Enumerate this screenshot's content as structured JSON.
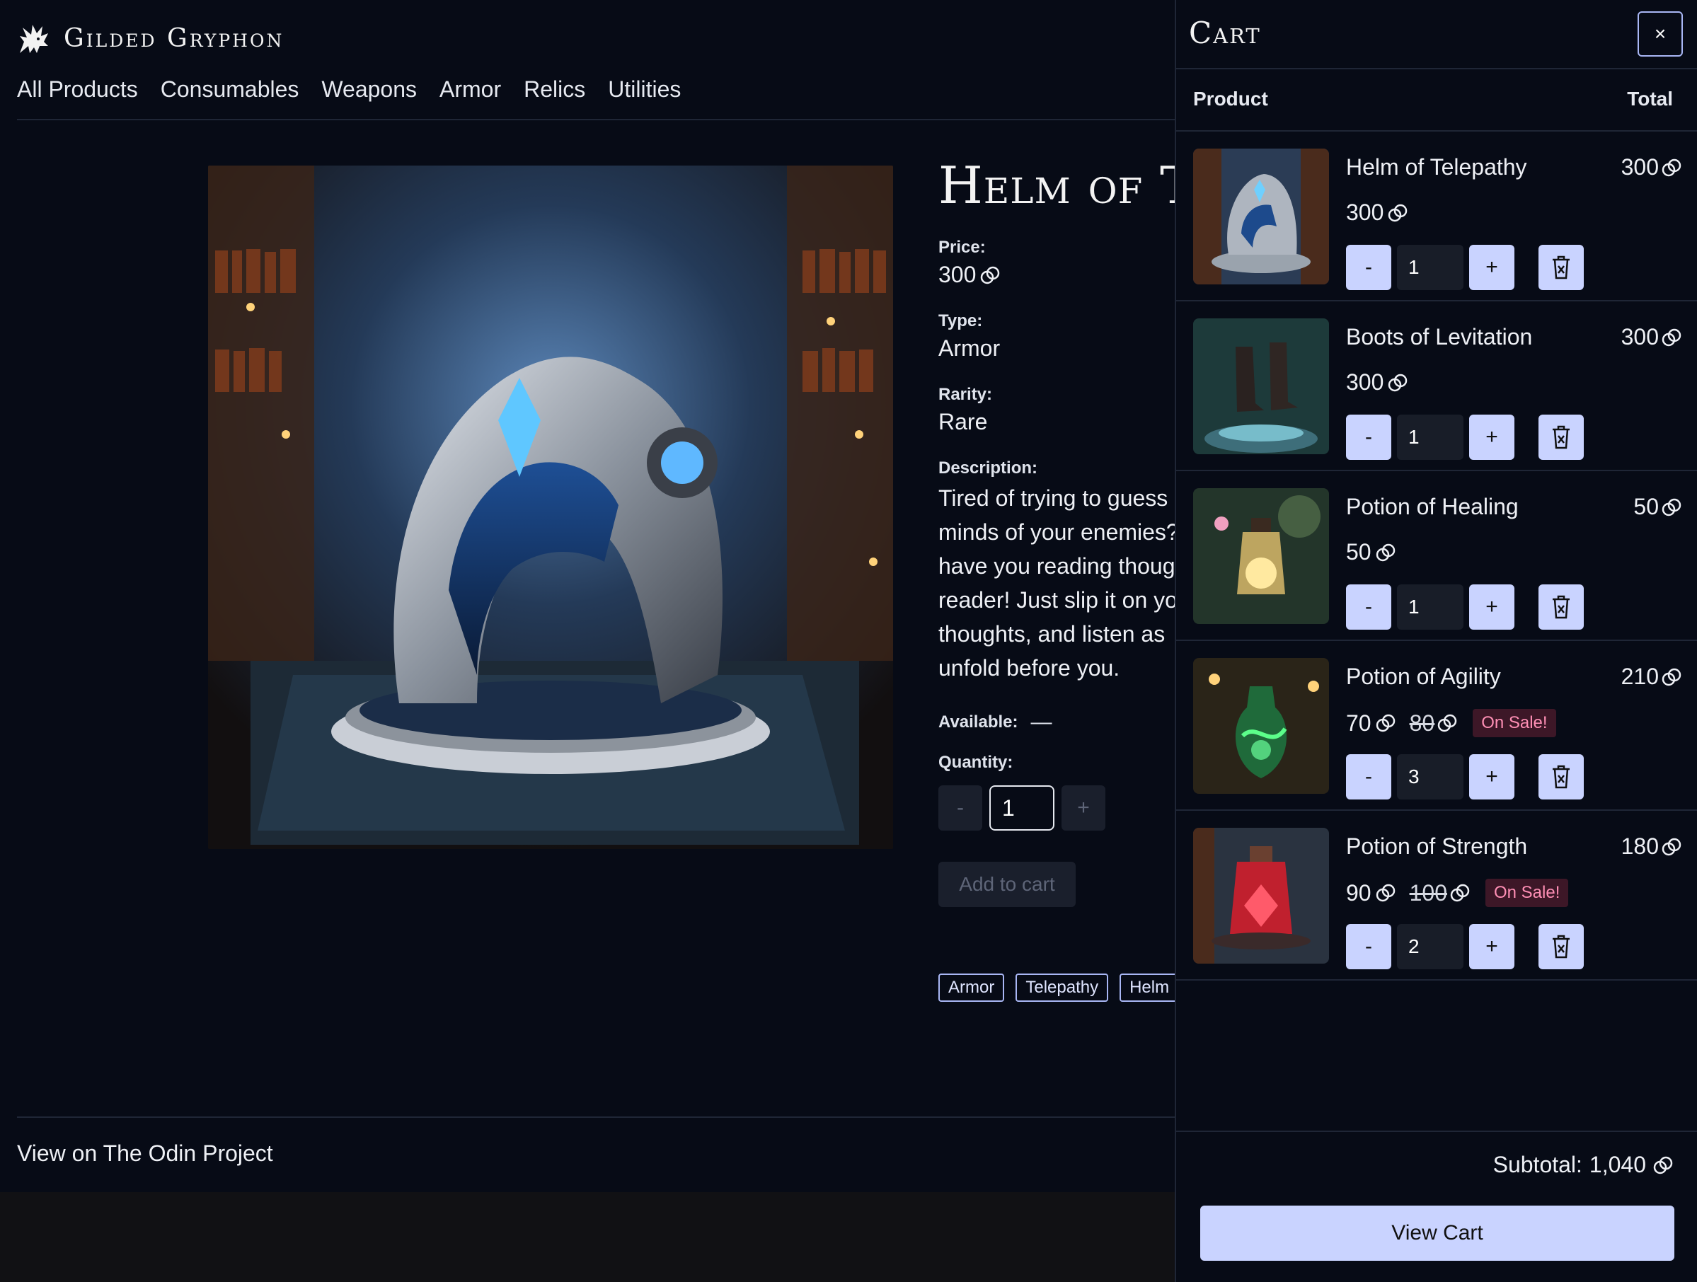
{
  "brand": {
    "name": "Gilded Gryphon",
    "logo_icon": "gryphon-icon"
  },
  "nav": [
    "All Products",
    "Consumables",
    "Weapons",
    "Armor",
    "Relics",
    "Utilities"
  ],
  "product": {
    "title": "Helm of T",
    "price_label": "Price:",
    "price": "300",
    "type_label": "Type:",
    "type": "Armor",
    "rarity_label": "Rarity:",
    "rarity": "Rare",
    "description_label": "Description:",
    "description_lines": [
      "Tired of trying to guess",
      "minds of your enemies?",
      "have you reading thoug",
      "reader! Just slip it on yo",
      "thoughts, and listen as",
      "unfold before you."
    ],
    "available_label": "Available:",
    "available_value": "—",
    "quantity_label": "Quantity:",
    "quantity": "1",
    "minus": "-",
    "plus": "+",
    "add_to_cart": "Add to cart",
    "tags": [
      "Armor",
      "Telepathy",
      "Helm"
    ]
  },
  "footer": {
    "link": "View on The Odin Project"
  },
  "cart": {
    "title": "Cart",
    "close": "×",
    "col_product": "Product",
    "col_total": "Total",
    "minus": "-",
    "plus": "+",
    "items": [
      {
        "name": "Helm of Telepathy",
        "price": "300",
        "old_price": "",
        "badge": "",
        "qty": "1",
        "total": "300"
      },
      {
        "name": "Boots of Levitation",
        "price": "300",
        "old_price": "",
        "badge": "",
        "qty": "1",
        "total": "300"
      },
      {
        "name": "Potion of Healing",
        "price": "50",
        "old_price": "",
        "badge": "",
        "qty": "1",
        "total": "50"
      },
      {
        "name": "Potion of Agility",
        "price": "70",
        "old_price": "80",
        "badge": "On Sale!",
        "qty": "3",
        "total": "210"
      },
      {
        "name": "Potion of Strength",
        "price": "90",
        "old_price": "100",
        "badge": "On Sale!",
        "qty": "2",
        "total": "180"
      }
    ],
    "subtotal_label": "Subtotal:",
    "subtotal": "1,040",
    "view_cart": "View Cart"
  },
  "colors": {
    "background": "#070b16",
    "accent": "#c9d3ff",
    "sale_text": "#ff8fb5",
    "sale_bg": "#3d1727"
  }
}
